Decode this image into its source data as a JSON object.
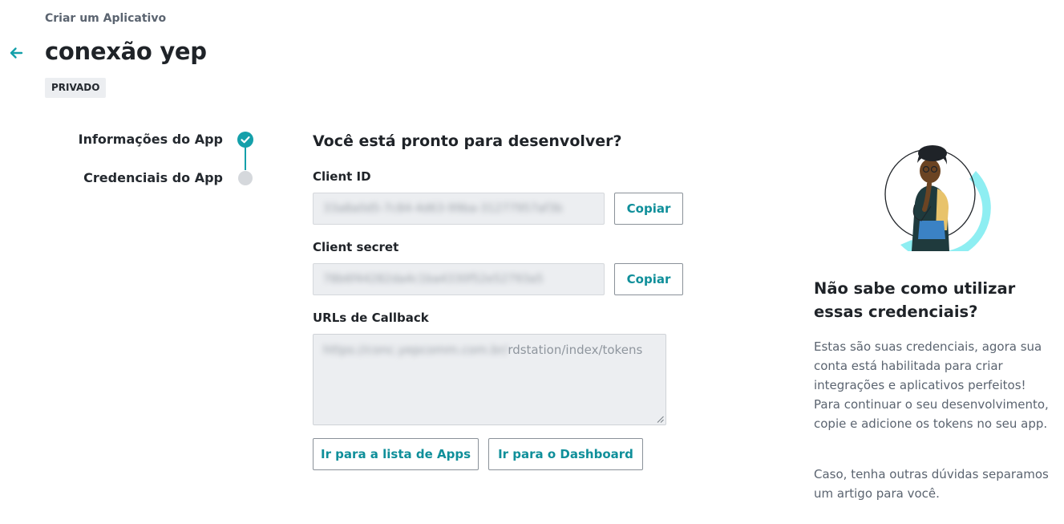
{
  "header": {
    "breadcrumb": "Criar um Aplicativo",
    "title": "conexão yep",
    "badge": "PRIVADO",
    "back_icon": "arrow-left-icon"
  },
  "stepper": {
    "steps": [
      {
        "label": "Informações do App",
        "status": "completed"
      },
      {
        "label": "Credenciais do App",
        "status": "current"
      }
    ],
    "accent_color": "#14a0aa",
    "inactive_color": "#d5d8dc"
  },
  "form": {
    "title": "Você está pronto para desenvolver?",
    "client_id": {
      "label": "Client ID",
      "value_redacted": "33a8a0d5-7c84-4d63-99ba-31277957af3b",
      "copy_label": "Copiar"
    },
    "client_secret": {
      "label": "Client secret",
      "value_redacted": "78b6f44282da4c1ba4330f52e52793a5",
      "copy_label": "Copiar"
    },
    "callback": {
      "label": "URLs de Callback",
      "value_redacted": "https://conc.yepcomm.com.br/",
      "value_visible": "rdstation/index/tokens"
    },
    "buttons": {
      "apps_list": "Ir para a lista de Apps",
      "dashboard": "Ir para o Dashboard"
    }
  },
  "help": {
    "title": "Não sabe como utilizar essas credenciais?",
    "paragraph_1": "Estas são suas credenciais, agora sua conta está habilitada para criar integrações e aplicativos perfeitos! Para continuar o seu desenvolvimento, copie e adicione os tokens no seu app.",
    "paragraph_2": "Caso, tenha outras dúvidas separamos um artigo para você.",
    "illustration": "person-thinking-illustration"
  },
  "colors": {
    "accent": "#14a0aa",
    "button_text": "#0f8f9a",
    "field_bg": "#eceef1",
    "illustration_cyan": "#8eeef2"
  }
}
